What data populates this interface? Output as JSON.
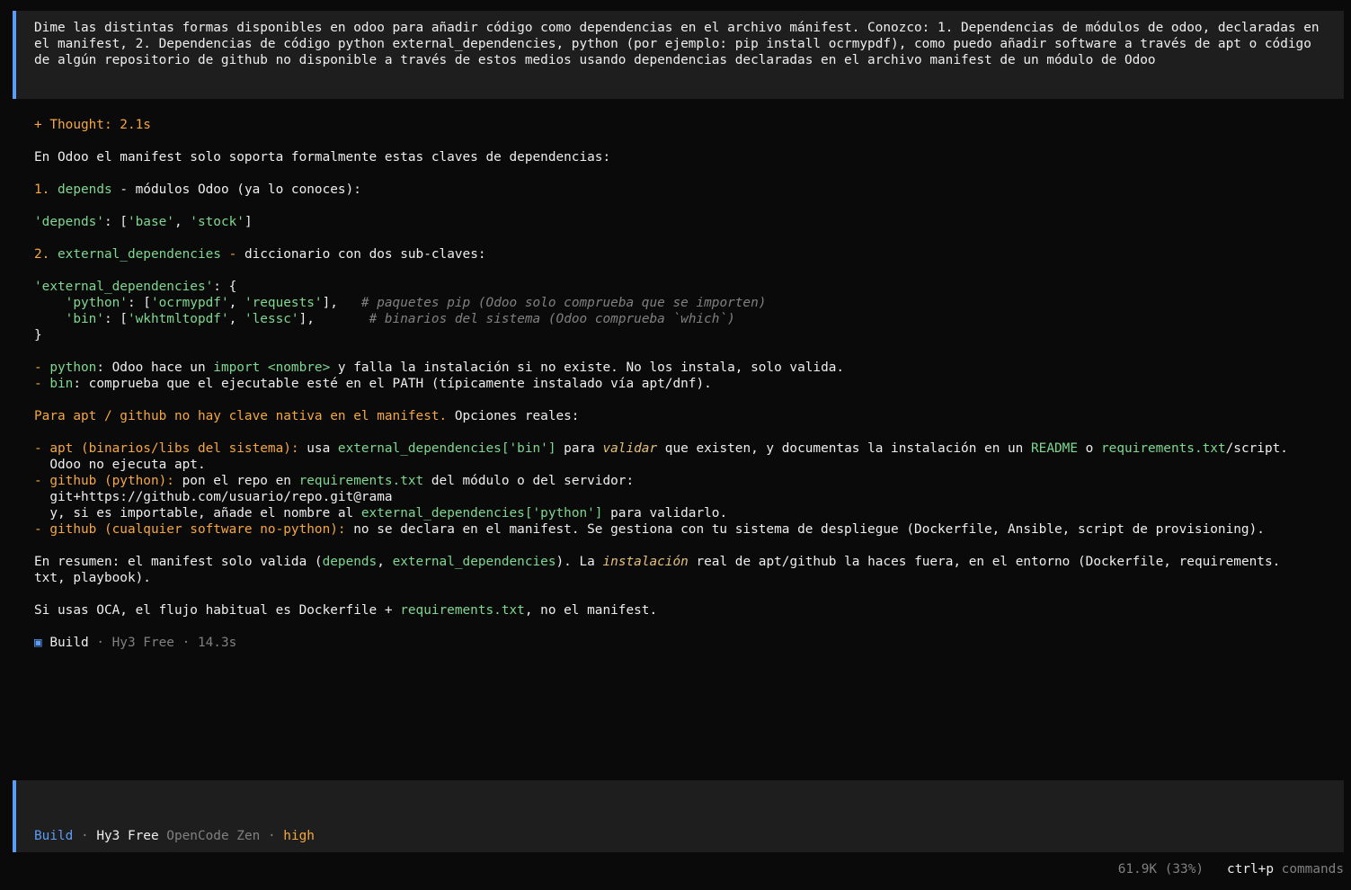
{
  "user_message": "Dime las distintas formas disponibles en odoo para añadir código como dependencias en el archivo mánifest. Conozco: 1. Dependencias de módulos de odoo, declaradas en el manifest, 2. Dependencias de código python external_dependencies, python (por ejemplo: pip install ocrmypdf), como puedo añadir software a través de apt o código de algún repositorio de github no disponible a través de estos medios usando dependencias declaradas en el archivo manifest de un módulo de Odoo",
  "thought": "+ Thought: 2.1s",
  "intro": "En Odoo el manifest solo soporta formalmente estas claves de dependencias:",
  "item1": {
    "num": "1. ",
    "key": "depends",
    "rest": " - módulos Odoo (ya lo conoces):"
  },
  "code1": {
    "k": "'depends'",
    "a": ": [",
    "v1": "'base'",
    "sep": ", ",
    "v2": "'stock'",
    "b": "]"
  },
  "item2": {
    "num": "2. ",
    "key": "external_dependencies",
    "dash": " - ",
    "rest": "diccionario con dos sub-claves:"
  },
  "code2": {
    "l1k": "'external_dependencies'",
    "l1r": ": {",
    "l2ind": "    ",
    "l2k": "'python'",
    "l2a": ": [",
    "l2v1": "'ocrmypdf'",
    "l2sep": ", ",
    "l2v2": "'requests'",
    "l2b": "],   ",
    "l2c": "# paquetes pip (Odoo solo comprueba que se importen)",
    "l3ind": "    ",
    "l3k": "'bin'",
    "l3a": ": [",
    "l3v1": "'wkhtmltopdf'",
    "l3sep": ", ",
    "l3v2": "'lessc'",
    "l3b": "],       ",
    "l3c": "# binarios del sistema (Odoo comprueba `which`)",
    "l4": "}"
  },
  "b_python": {
    "dash": "- ",
    "key": "python",
    "t1": ": Odoo hace un ",
    "imp": "import <nombre>",
    "t2": " y falla la instalación si no existe. No los instala, solo valida."
  },
  "b_bin": {
    "dash": "- ",
    "key": "bin",
    "t1": ": comprueba que el ejecutable esté en el PATH (típicamente instalado vía apt/dnf)."
  },
  "apt_heading": {
    "o": "Para apt / github no hay clave nativa en el manifest.",
    "w": " Opciones reales:"
  },
  "opt_apt": {
    "dash": "- apt (binarios/libs del sistema):",
    "t1": " usa ",
    "g1": "external_dependencies['bin']",
    "t2": " para ",
    "it": "validar",
    "t3": " que existen, y documentas la instalación en un ",
    "g2": "README",
    "t4": " o ",
    "g3": "requirements.txt",
    "t5": "/script."
  },
  "opt_apt2": "  Odoo no ejecuta apt.",
  "opt_gh": {
    "dash": "- github (python):",
    "t1": " pon el repo en ",
    "g1": "requirements.txt",
    "t2": " del módulo o del servidor:"
  },
  "opt_gh2": "  git+https://github.com/usuario/repo.git@rama",
  "opt_gh3": {
    "t1": "  y, si es importable, añade el nombre al ",
    "g1": "external_dependencies['python']",
    "t2": " para validarlo."
  },
  "opt_any": {
    "dash": "- github (cualquier software no-python):",
    "t1": " no se declara en el manifest. Se gestiona con tu sistema de despliegue (Dockerfile, Ansible, script de provisioning)."
  },
  "summary": {
    "t1": "En resumen: el manifest solo valida (",
    "g1": "depends",
    "s": ", ",
    "g2": "external_dependencies",
    "t2": "). La ",
    "it": "instalación",
    "t3": " real de apt/github la haces fuera, en el entorno (Dockerfile, requirements."
  },
  "summary2": "txt, playbook).",
  "oca": {
    "t1": "Si usas OCA, el flujo habitual es Dockerfile + ",
    "g1": "requirements.txt",
    "t2": ", no el manifest."
  },
  "build_row": {
    "icon": "▣",
    "mode": " Build",
    "meta": " · Hy3 Free · 14.3s"
  },
  "input_status": {
    "mode": "Build",
    "dot1": " · ",
    "model": "Hy3 Free",
    "provider": " OpenCode Zen",
    "dot2": " · ",
    "effort": "high"
  },
  "footer": {
    "tokens": "61.9K (33%)",
    "shortcut": "ctrl+p",
    "label": " commands"
  }
}
